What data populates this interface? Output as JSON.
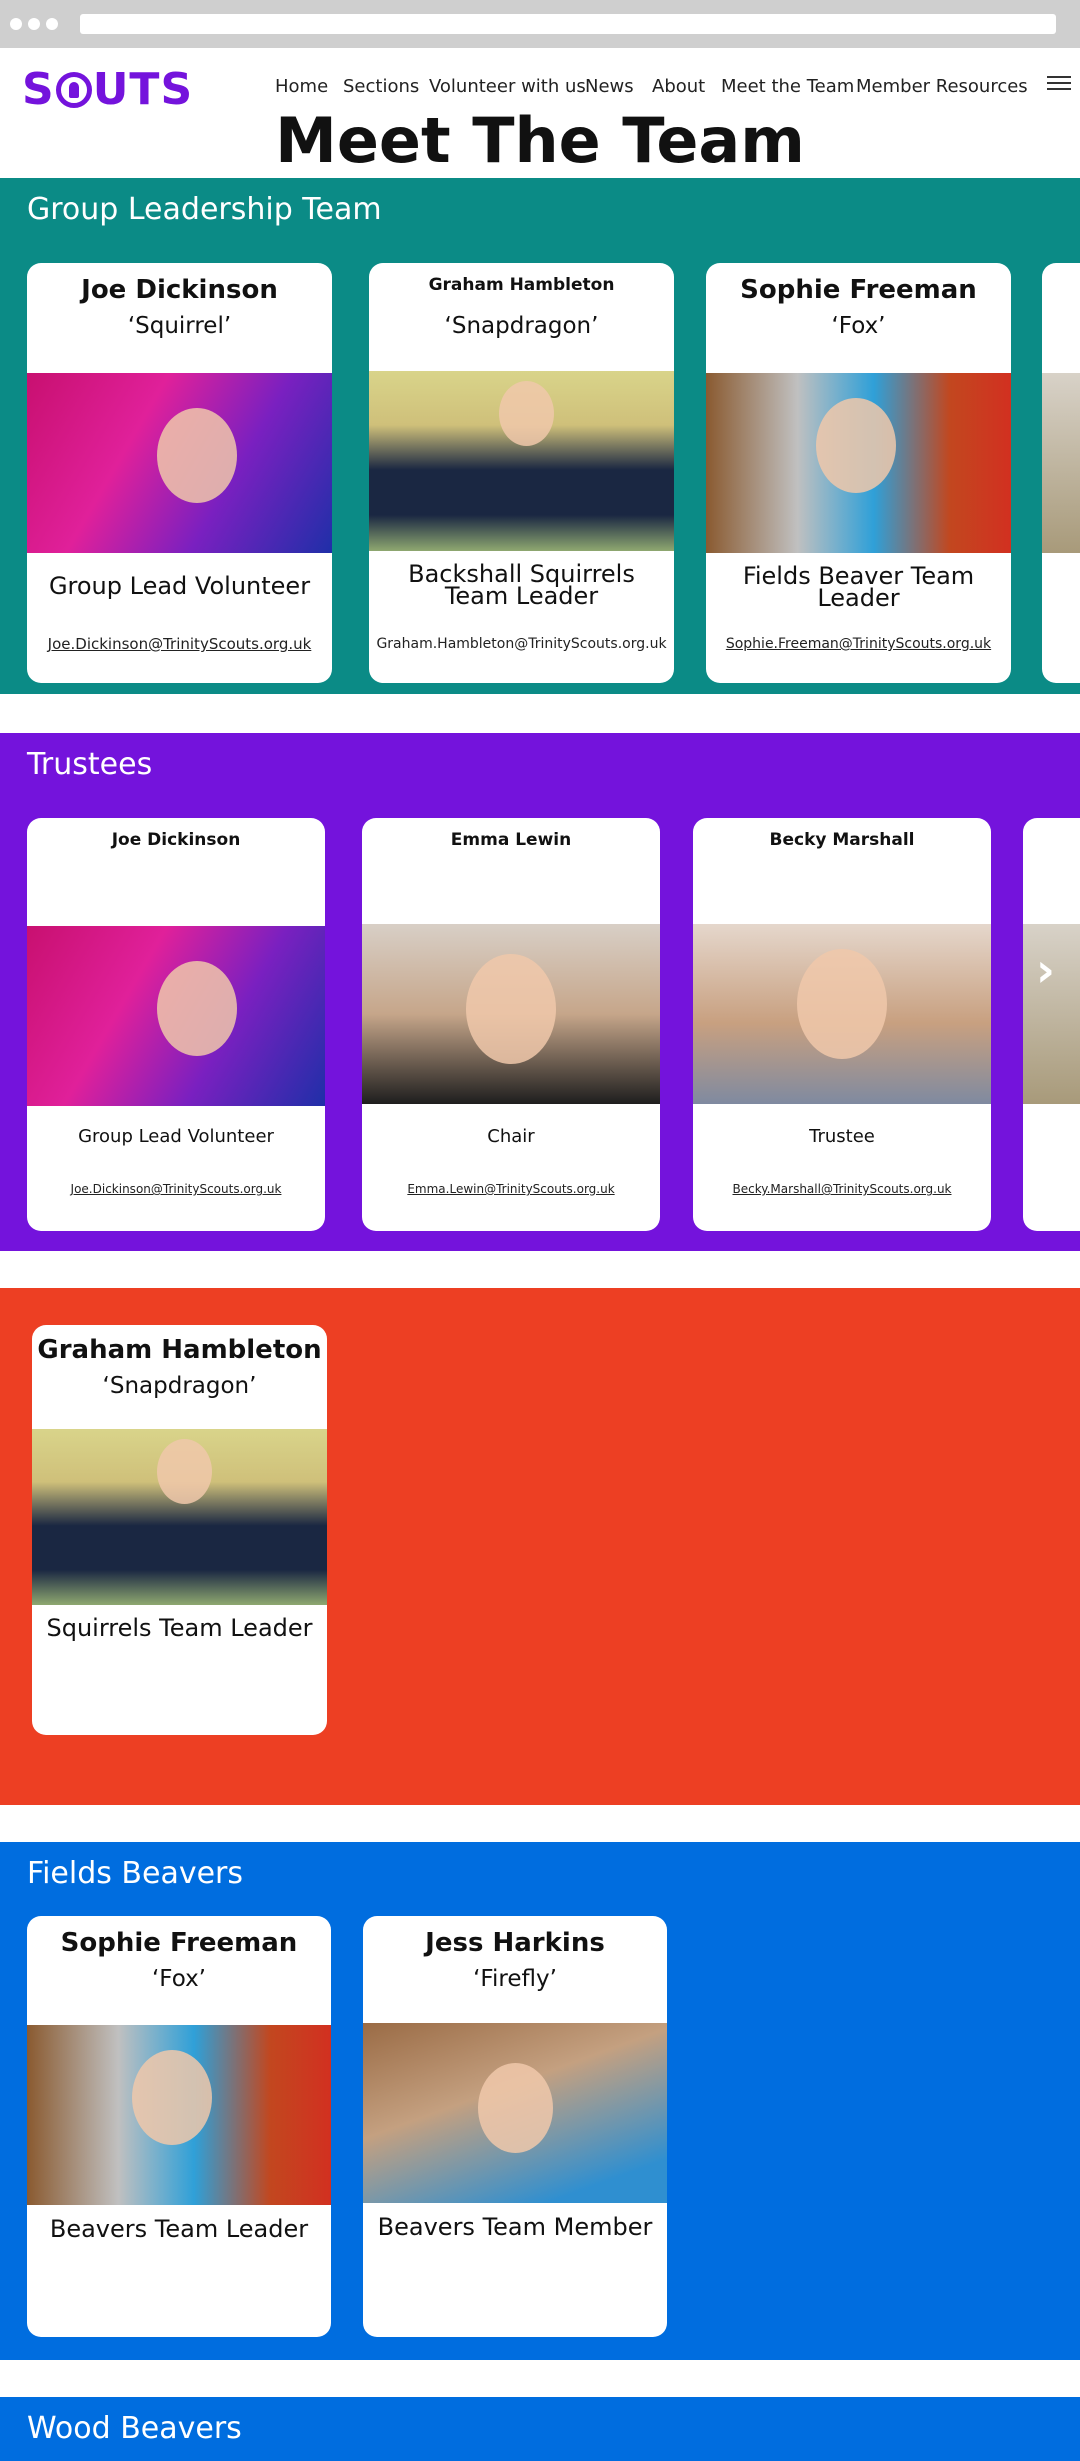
{
  "nav": {
    "logo": "SCOUTS",
    "links": [
      "Home",
      "Sections",
      "Volunteer with us",
      "News",
      "About",
      "Meet the Team",
      "Member Resources"
    ]
  },
  "page_title": "Meet The Team",
  "colors": {
    "teal": "#0b8b86",
    "purple": "#7413dc",
    "red": "#ed3f23",
    "blue": "#006ddf",
    "white": "#ffffff"
  },
  "sections": {
    "group_leadership": {
      "title": "Group Leadership Team",
      "cards": [
        {
          "name": "Joe Dickinson",
          "nick": "‘Squirrel’",
          "role": "Group Lead Volunteer",
          "email": "Joe.Dickinson@TrinityScouts.org.uk"
        },
        {
          "name": "Graham Hambleton",
          "nick": "‘Snapdragon’",
          "role": "Backshall Squirrels Team Leader",
          "email": "Graham.Hambleton@TrinityScouts.org.uk"
        },
        {
          "name": "Sophie Freeman",
          "nick": "‘Fox’",
          "role": "Fields Beaver Team Leader",
          "email": "Sophie.Freeman@TrinityScouts.org.uk"
        }
      ]
    },
    "trustees": {
      "title": "Trustees",
      "cards": [
        {
          "name": "Joe Dickinson",
          "role": "Group Lead Volunteer",
          "email": "Joe.Dickinson@TrinityScouts.org.uk"
        },
        {
          "name": "Emma Lewin",
          "role": "Chair",
          "email": "Emma.Lewin@TrinityScouts.org.uk"
        },
        {
          "name": "Becky Marshall",
          "role": "Trustee",
          "email": "Becky.Marshall@TrinityScouts.org.uk"
        }
      ],
      "next_arrow": "›"
    },
    "squirrels": {
      "cards": [
        {
          "name": "Graham Hambleton",
          "nick": "‘Snapdragon’",
          "role": "Squirrels Team Leader"
        }
      ]
    },
    "fields_beavers": {
      "title": "Fields Beavers",
      "cards": [
        {
          "name": "Sophie Freeman",
          "nick": "‘Fox’",
          "role": "Beavers Team Leader"
        },
        {
          "name": "Jess Harkins",
          "nick": "‘Firefly’",
          "role": "Beavers Team Member"
        }
      ]
    },
    "wood_beavers": {
      "title": "Wood Beavers"
    }
  }
}
